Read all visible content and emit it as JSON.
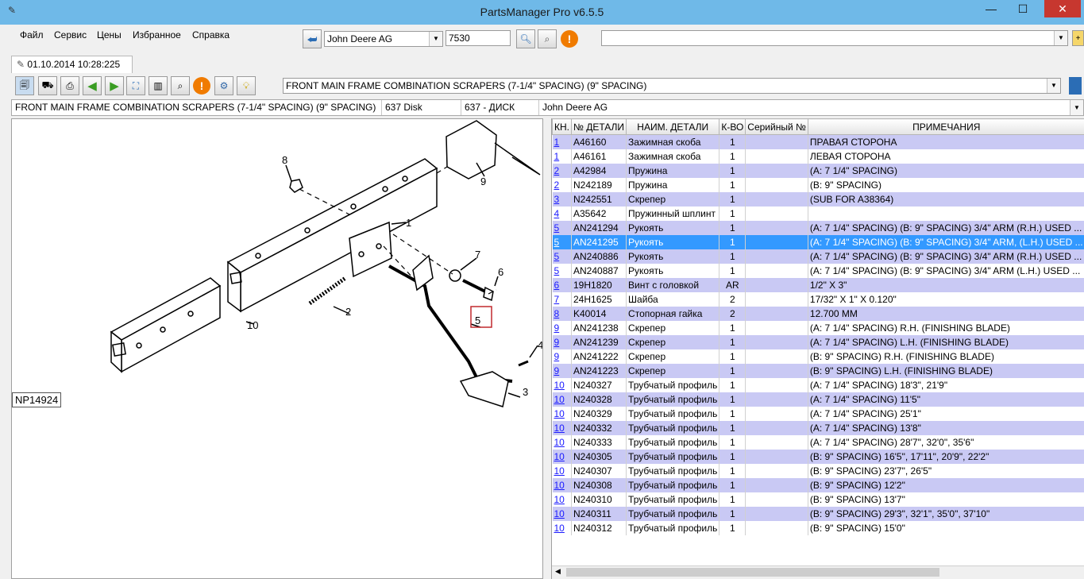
{
  "window": {
    "title": "PartsManager Pro v6.5.5",
    "min": "—",
    "max": "☐",
    "close": "✕"
  },
  "menu": [
    "Файл",
    "Сервис",
    "Цены",
    "Избранное",
    "Справка"
  ],
  "search": {
    "manufacturer": "John Deere AG",
    "model": "7530",
    "right_combo": ""
  },
  "tab": {
    "label": "01.10.2014 10:28:225"
  },
  "breadcrumb_combo": "FRONT MAIN FRAME COMBINATION SCRAPERS (7-1/4\" SPACING) (9\" SPACING)",
  "info": {
    "group": "FRONT MAIN FRAME COMBINATION SCRAPERS (7-1/4\" SPACING) (9\" SPACING)",
    "code": "637 Disk",
    "code_ru": "637 - ДИСК",
    "maker": "John Deere AG"
  },
  "drawing": {
    "np_label": "NP14924",
    "callouts": [
      "8",
      "9",
      "1",
      "7",
      "6",
      "2",
      "5",
      "10",
      "4",
      "3"
    ]
  },
  "table": {
    "headers": [
      "КН.",
      "№ ДЕТАЛИ",
      "НАИМ. ДЕТАЛИ",
      "К-ВО",
      "Серийный №",
      "ПРИМЕЧАНИЯ"
    ],
    "rows": [
      [
        "1",
        "A46160",
        "Зажимная скоба",
        "1",
        "",
        "ПРАВАЯ СТОРОНА"
      ],
      [
        "1",
        "A46161",
        "Зажимная скоба",
        "1",
        "",
        "ЛЕВАЯ СТОРОНА"
      ],
      [
        "2",
        "A42984",
        "Пружина",
        "1",
        "",
        "(A: 7 1/4\" SPACING)"
      ],
      [
        "2",
        "N242189",
        "Пружина",
        "1",
        "",
        "(B: 9\" SPACING)"
      ],
      [
        "3",
        "N242551",
        "Скрепер",
        "1",
        "",
        "(SUB FOR A38364)"
      ],
      [
        "4",
        "A35642",
        "Пружинный шплинт",
        "1",
        "",
        ""
      ],
      [
        "5",
        "AN241294",
        "Рукоять",
        "1",
        "",
        "(A: 7 1/4\" SPACING) (B: 9\" SPACING) 3/4\" ARM (R.H.) USED ..."
      ],
      [
        "5",
        "AN241295",
        "Рукоять",
        "1",
        "",
        "(A: 7 1/4\" SPACING) (B: 9\" SPACING) 3/4\" ARM, (L.H.) USED ..."
      ],
      [
        "5",
        "AN240886",
        "Рукоять",
        "1",
        "",
        "(A: 7 1/4\" SPACING) (B: 9\" SPACING) 3/4\" ARM (R.H.) USED ..."
      ],
      [
        "5",
        "AN240887",
        "Рукоять",
        "1",
        "",
        "(A: 7 1/4\" SPACING) (B: 9\" SPACING) 3/4\" ARM (L.H.) USED ..."
      ],
      [
        "6",
        "19H1820",
        "Винт с головкой",
        "AR",
        "",
        "1/2\" X 3\""
      ],
      [
        "7",
        "24H1625",
        "Шайба",
        "2",
        "",
        "17/32\" X 1\" X 0.120\""
      ],
      [
        "8",
        "K40014",
        "Стопорная гайка",
        "2",
        "",
        "12.700 MM"
      ],
      [
        "9",
        "AN241238",
        "Скрепер",
        "1",
        "",
        "(A: 7 1/4\" SPACING) R.H. (FINISHING BLADE)"
      ],
      [
        "9",
        "AN241239",
        "Скрепер",
        "1",
        "",
        "(A: 7 1/4\" SPACING) L.H. (FINISHING BLADE)"
      ],
      [
        "9",
        "AN241222",
        "Скрепер",
        "1",
        "",
        "(B: 9\" SPACING) R.H. (FINISHING BLADE)"
      ],
      [
        "9",
        "AN241223",
        "Скрепер",
        "1",
        "",
        "(B: 9\" SPACING) L.H. (FINISHING BLADE)"
      ],
      [
        "10",
        "N240327",
        "Трубчатый профиль",
        "1",
        "",
        "(A: 7 1/4\" SPACING) 18'3\", 21'9\""
      ],
      [
        "10",
        "N240328",
        "Трубчатый профиль",
        "1",
        "",
        "(A: 7 1/4\" SPACING) 11'5\""
      ],
      [
        "10",
        "N240329",
        "Трубчатый профиль",
        "1",
        "",
        "(A: 7 1/4\" SPACING) 25'1\""
      ],
      [
        "10",
        "N240332",
        "Трубчатый профиль",
        "1",
        "",
        "(A: 7 1/4\" SPACING) 13'8\""
      ],
      [
        "10",
        "N240333",
        "Трубчатый профиль",
        "1",
        "",
        "(A: 7 1/4\" SPACING) 28'7\", 32'0\", 35'6\""
      ],
      [
        "10",
        "N240305",
        "Трубчатый профиль",
        "1",
        "",
        "(B: 9\" SPACING) 16'5\", 17'11\", 20'9\", 22'2\""
      ],
      [
        "10",
        "N240307",
        "Трубчатый профиль",
        "1",
        "",
        "(B: 9\" SPACING) 23'7\", 26'5\""
      ],
      [
        "10",
        "N240308",
        "Трубчатый профиль",
        "1",
        "",
        "(B: 9\" SPACING) 12'2\""
      ],
      [
        "10",
        "N240310",
        "Трубчатый профиль",
        "1",
        "",
        "(B: 9\" SPACING) 13'7\""
      ],
      [
        "10",
        "N240311",
        "Трубчатый профиль",
        "1",
        "",
        "(B: 9\" SPACING) 29'3\", 32'1\", 35'0\", 37'10\""
      ],
      [
        "10",
        "N240312",
        "Трубчатый профиль",
        "1",
        "",
        "(B: 9\" SPACING) 15'0\""
      ]
    ],
    "selected_index": 7
  },
  "colors": {
    "titlebar": "#6fb9e8",
    "row_alt": "#c9c9f4",
    "row_selected": "#3399ff",
    "link": "#1a1aff"
  },
  "icons": [
    "app-icon",
    "back-icon",
    "search-catalog-icon",
    "zoom-icon",
    "warning-icon",
    "add-icon",
    "print-icon",
    "arrow-left-icon",
    "arrow-right-icon",
    "fit-icon",
    "columns-icon",
    "settings-icon",
    "bulb-icon",
    "book-icon"
  ]
}
